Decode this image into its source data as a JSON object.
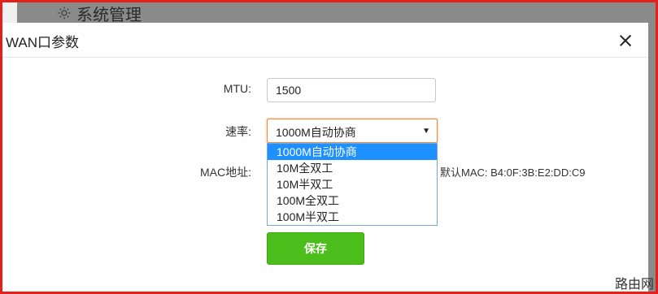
{
  "background": {
    "section_title": "系统管理",
    "icon": "gear-icon"
  },
  "modal": {
    "title": "WAN口参数",
    "close_icon": "close-icon"
  },
  "form": {
    "mtu_label": "MTU:",
    "mtu_value": "1500",
    "speed_label": "速率:",
    "speed_selected": "1000M自动协商",
    "speed_options": [
      "1000M自动协商",
      "10M全双工",
      "10M半双工",
      "100M全双工",
      "100M半双工"
    ],
    "mac_label": "MAC地址:",
    "mac_default": "默认MAC: B4:0F:3B:E2:DD:C9",
    "save_label": "保存"
  },
  "watermark": "路由网",
  "colors": {
    "frame": "#e3201b",
    "save_button": "#4cbe1b",
    "dropdown_highlight": "#1e90ff",
    "select_focus": "#f08a3c"
  }
}
